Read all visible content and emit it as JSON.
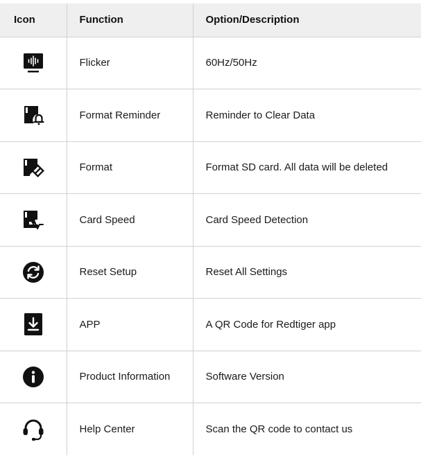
{
  "table": {
    "headers": {
      "icon": "Icon",
      "function": "Function",
      "description": "Option/Description"
    },
    "rows": [
      {
        "icon": "flicker-icon",
        "function": "Flicker",
        "description": "60Hz/50Hz"
      },
      {
        "icon": "format-reminder-icon",
        "function": "Format Reminder",
        "description": "Reminder to Clear Data"
      },
      {
        "icon": "format-icon",
        "function": "Format",
        "description": "Format SD card. All data will be deleted"
      },
      {
        "icon": "card-speed-icon",
        "function": "Card Speed",
        "description": "Card Speed Detection"
      },
      {
        "icon": "reset-setup-icon",
        "function": "Reset Setup",
        "description": "Reset All Settings"
      },
      {
        "icon": "app-download-icon",
        "function": "APP",
        "description": "A QR Code for Redtiger app"
      },
      {
        "icon": "info-icon",
        "function": "Product Information",
        "description": "Software Version"
      },
      {
        "icon": "headset-icon",
        "function": "Help Center",
        "description": "Scan the QR code to contact us"
      }
    ]
  },
  "colors": {
    "icon": "#111111",
    "header_bg": "#efefef",
    "border": "#d0d0d0"
  }
}
